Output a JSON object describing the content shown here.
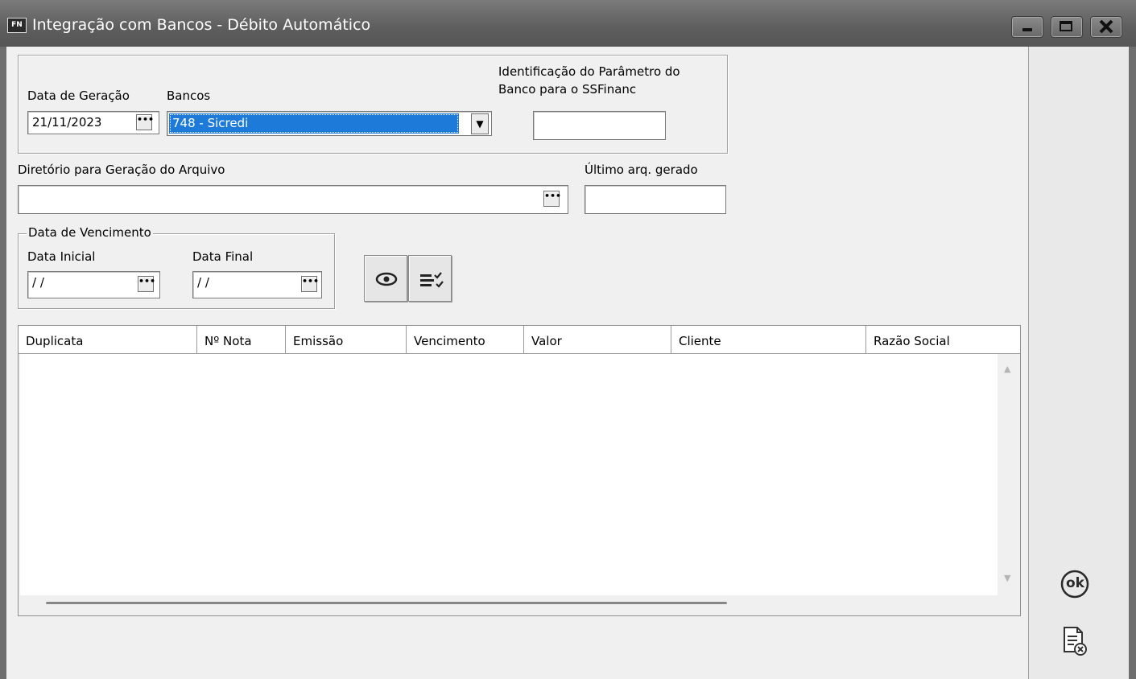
{
  "window": {
    "app_icon": "FN",
    "title": "Integração com Bancos  - Débito  Automático",
    "controls": [
      "minimize-icon",
      "maximize-icon",
      "close-icon"
    ]
  },
  "generation": {
    "date_label": "Data de Geração",
    "date_value": "21/11/2023",
    "banks_label": "Bancos",
    "bank_selected": "748 - Sicredi",
    "param_label_line1": "Identificação do Parâmetro do",
    "param_label_line2": "Banco para o SSFinanc",
    "param_value": ""
  },
  "directory": {
    "label": "Diretório para Geração do Arquivo",
    "value": "",
    "last_file_label": "Último arq. gerado",
    "last_file_value": ""
  },
  "due_date": {
    "group_label": "Data de Vencimento",
    "start_label": "Data Inicial",
    "start_value": " /  /",
    "end_label": "Data Final",
    "end_value": " /  /"
  },
  "toolbar": {
    "view_icon": "eye-icon",
    "select_icon": "checklist-icon"
  },
  "grid": {
    "columns": [
      "Duplicata",
      "Nº Nota",
      "Emissão",
      "Vencimento",
      "Valor",
      "Cliente",
      "Razão Social"
    ],
    "rows": []
  },
  "side_actions": {
    "ok_text": "ok",
    "cancel_icon": "cancel-document-icon"
  },
  "colors": {
    "titlebar": "#5e5e5e",
    "selection": "#1e7ad9",
    "background": "#f0f0f0"
  }
}
